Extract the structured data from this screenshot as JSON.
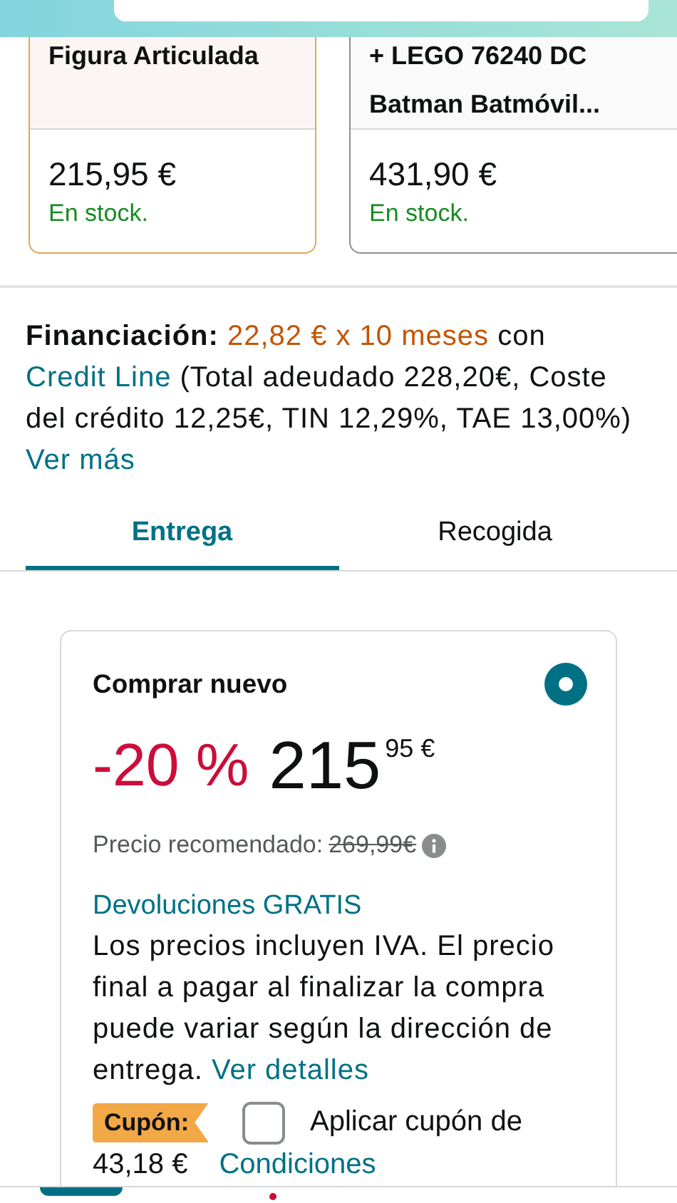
{
  "products": [
    {
      "title": "Figura Articulada",
      "price": "215,95 €",
      "stock": "En stock.",
      "selected": true
    },
    {
      "title": "+ LEGO 76240 DC Batman Batmóvil...",
      "price": "431,90 €",
      "stock": "En stock.",
      "selected": false
    }
  ],
  "financing": {
    "label": "Financiación:",
    "amount": "22,82 € x 10 meses",
    "text_1": "con",
    "link": "Credit Line",
    "text_2": "(Total adeudado 228,20€, Coste del crédito 12,25€, TIN 12,29%, TAE 13,00%)",
    "more_link": "Ver más"
  },
  "tabs": [
    {
      "label": "Entrega",
      "selected": true
    },
    {
      "label": "Recogida",
      "selected": false
    }
  ],
  "offer": {
    "title": "Comprar nuevo",
    "selected": true,
    "discount": "-20 %",
    "price_whole": "215",
    "price_fraction": "95",
    "currency": "€",
    "list_price_label": "Precio recomendado:",
    "list_price": "269,99€",
    "returns": "Devoluciones GRATIS",
    "tax_note": "Los precios incluyen IVA. El precio final a pagar al finalizar la compra puede variar según la dirección de entrega.",
    "details_link": "Ver detalles",
    "coupon": {
      "badge": "Cupón:",
      "checked": false,
      "text": "Aplicar cupón de",
      "amount": "43,18 €",
      "link": "Condiciones"
    }
  }
}
